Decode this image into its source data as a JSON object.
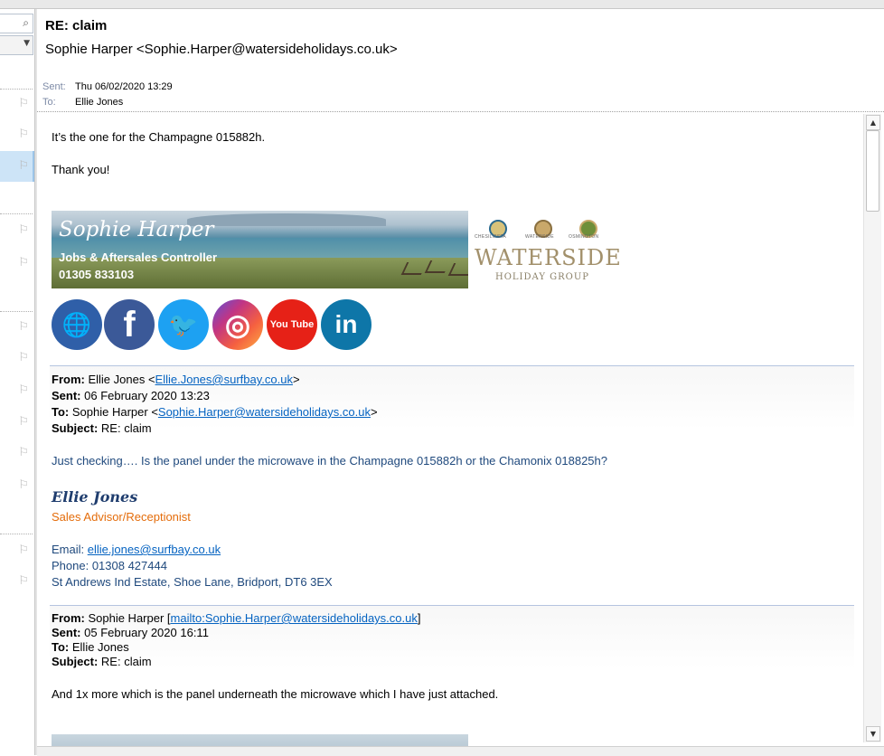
{
  "header": {
    "subject": "RE: claim",
    "sender": "Sophie Harper <Sophie.Harper@watersideholidays.co.uk>",
    "sent_label": "Sent:",
    "sent_value": "Thu 06/02/2020 13:29",
    "to_label": "To:",
    "to_value": "Ellie Jones"
  },
  "body": {
    "line1": "It’s the one for the Champagne 015882h.",
    "line2": "Thank you!",
    "signature_banner": {
      "name": "Sophie Harper",
      "role": "Jobs & Aftersales Controller",
      "phone": "01305 833103"
    },
    "logo": {
      "brands": [
        "CHESILVISTA",
        "WATERSIDE",
        "OSMINGTON"
      ],
      "title": "WATERSIDE",
      "subtitle": "HOLIDAY GROUP"
    },
    "social": [
      {
        "icon": "www-globe-icon",
        "glyph": "🌐",
        "color": "#2f5fa8"
      },
      {
        "icon": "facebook-icon",
        "glyph": "f",
        "color": "#3b5998"
      },
      {
        "icon": "twitter-icon",
        "glyph": "🐦",
        "color": "#1da1f2"
      },
      {
        "icon": "instagram-icon",
        "glyph": "◎",
        "color": "#c13584"
      },
      {
        "icon": "youtube-icon",
        "glyph": "You Tube",
        "color": "#e62117"
      },
      {
        "icon": "linkedin-icon",
        "glyph": "in",
        "color": "#0e76a8"
      }
    ],
    "quote1": {
      "from_label": "From:",
      "from_name": "Ellie Jones <",
      "from_email": "Ellie.Jones@surfbay.co.uk",
      "from_close": ">",
      "sent_label": "Sent:",
      "sent_value": "06 February 2020 13:23",
      "to_label": "To:",
      "to_name": "Sophie Harper <",
      "to_email": "Sophie.Harper@watersideholidays.co.uk",
      "to_close": ">",
      "subject_label": "Subject:",
      "subject_value": "RE: claim",
      "message": "Just checking…. Is the panel under the microwave in the Champagne 015882h or the Chamonix 018825h?",
      "sig_name": "Ellie Jones",
      "sig_title": "Sales Advisor/Receptionist",
      "email_label": "Email: ",
      "email_value": "ellie.jones@surfbay.co.uk",
      "phone": "Phone: 01308 427444",
      "address": "St Andrews Ind Estate, Shoe Lane, Bridport, DT6 3EX"
    },
    "quote2": {
      "from_label": "From:",
      "from_name": "Sophie Harper [",
      "from_email": "mailto:Sophie.Harper@watersideholidays.co.uk",
      "from_close": "]",
      "sent_label": "Sent:",
      "sent_value": "05 February 2020 16:11",
      "to_label": "To:",
      "to_value": "Ellie Jones",
      "subject_label": "Subject:",
      "subject_value": "RE: claim",
      "message": "And 1x more which is the panel underneath the microwave which I have just attached."
    }
  },
  "icons": {
    "search": "⌕",
    "dropdown": "▼",
    "flag": "⚐",
    "scroll_up": "▲",
    "scroll_down": "▼"
  }
}
